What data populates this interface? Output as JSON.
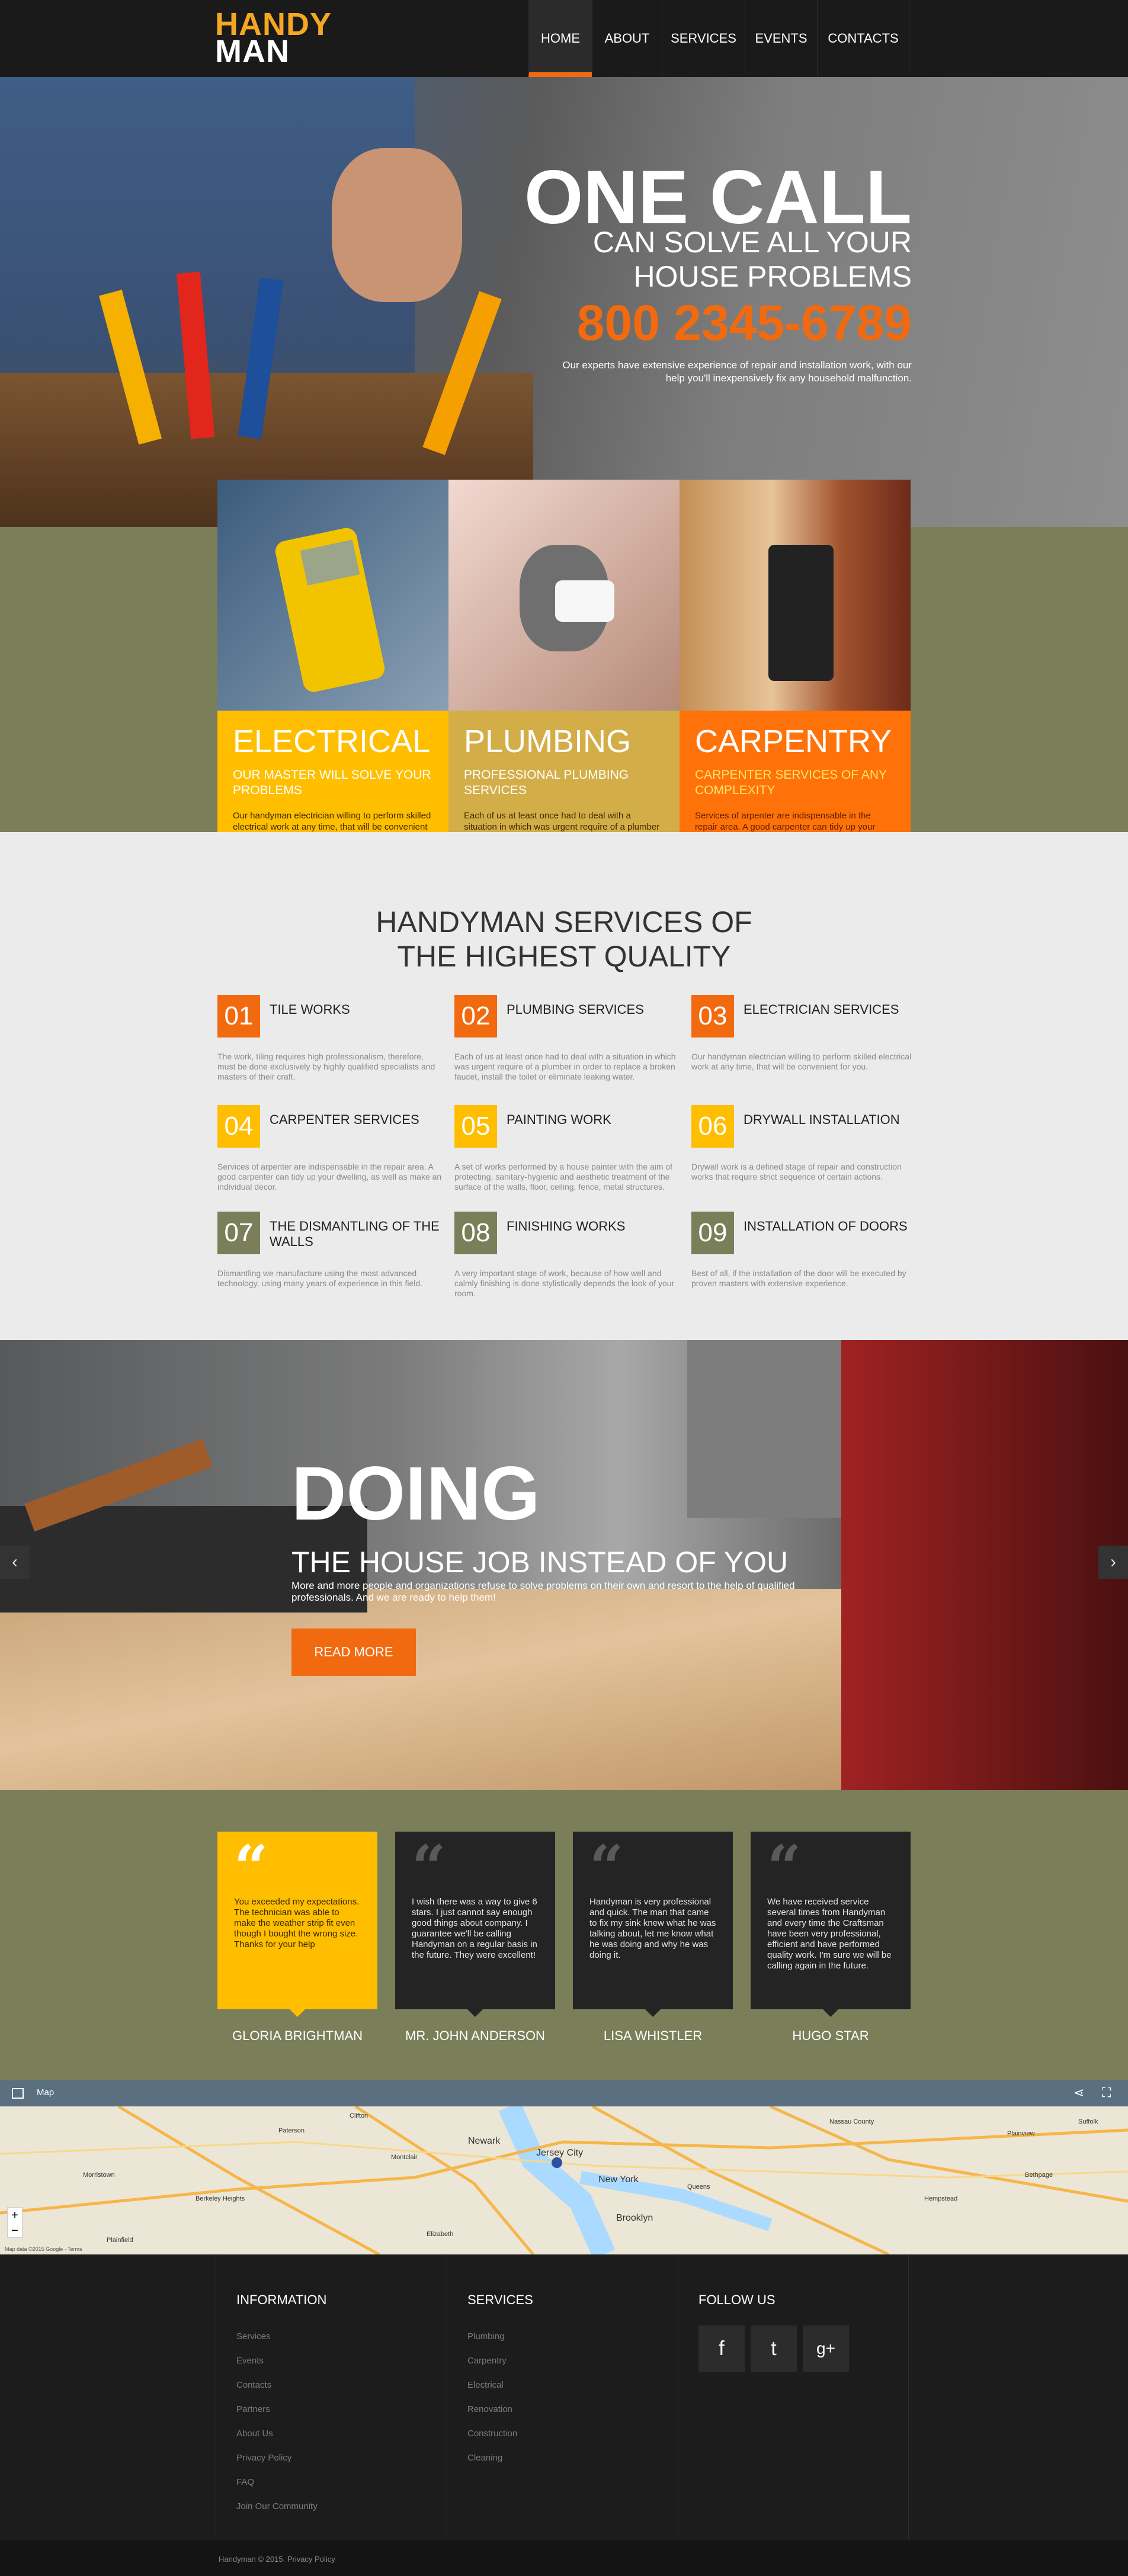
{
  "brand": {
    "line1": "HANDY",
    "line2": "MAN"
  },
  "nav": [
    {
      "label": "HOME",
      "active": true
    },
    {
      "label": "ABOUT",
      "active": false
    },
    {
      "label": "SERVICES",
      "active": false
    },
    {
      "label": "EVENTS",
      "active": false
    },
    {
      "label": "CONTACTS",
      "active": false
    }
  ],
  "hero": {
    "title": "ONE CALL",
    "subtitle": "CAN SOLVE ALL YOUR\nHOUSE PROBLEMS",
    "phone": "800 2345-6789",
    "text": "Our experts have extensive experience of repair and installation work, with our help you'll inexpensively fix any household malfunction."
  },
  "feature_cards": [
    {
      "title": "ELECTRICAL",
      "subtitle": "OUR MASTER WILL SOLVE YOUR PROBLEMS",
      "text": "Our handyman electrician willing to perform skilled electrical work at any time, that will be convenient for you. Electricity is communication, without which it would be difficult to imagine modern life.",
      "color": "#ffbe00"
    },
    {
      "title": "PLUMBING",
      "subtitle": "PROFESSIONAL PLUMBING SERVICES",
      "text": "Each of us at least once had to deal with a situation in which was urgent require of a plumber in order to replace a broken faucet, install the toilet or eliminate leaking water from the sewer pipes.",
      "color": "#d3ad47"
    },
    {
      "title": "CARPENTRY",
      "subtitle": "CARPENTER SERVICES OF ANY COMPLEXITY",
      "text": "Services of arpenter are  indispensable in the repair area. A good carpenter can tidy up your dwelling, as well as make an individual decor.",
      "color": "#ff720a"
    }
  ],
  "services_section": {
    "title": "HANDYMAN SERVICES OF\nTHE HIGHEST QUALITY",
    "items": [
      {
        "num": "01",
        "title": "TILE WORKS",
        "text": "The work, tiling requires high professionalism, therefore, must be done exclusively by highly qualified specialists and masters of their craft.",
        "color": "#f26a0f"
      },
      {
        "num": "04",
        "title": "CARPENTER SERVICES",
        "text": "Services of arpenter are  indispensable in the repair area. A good carpenter can tidy up your dwelling, as well as make an individual decor.",
        "color": "#ffbe00"
      },
      {
        "num": "07",
        "title": "THE DISMANTLING OF THE WALLS",
        "text": "Dismantling we manufacture using the most advanced technology, using many years of experience in this field.",
        "color": "#7a7f5a"
      },
      {
        "num": "02",
        "title": "PLUMBING SERVICES",
        "text": "Each of us at least once had to deal with a situation in which was urgent require of a plumber in order to replace a broken faucet, install the toilet or eliminate leaking water.",
        "color": "#f26a0f"
      },
      {
        "num": "05",
        "title": "PAINTING WORK",
        "text": "A set of works performed by a house painter with the aim of protecting, sanitary-hygienic and aesthetic treatment of the surface of the walls, floor, ceiling, fence, metal structures.",
        "color": "#ffbe00"
      },
      {
        "num": "08",
        "title": "FINISHING WORKS",
        "text": "A very important stage of work, because of how well and calmly finishing is done stylistically depends the look of your room.",
        "color": "#7a7f5a"
      },
      {
        "num": "03",
        "title": "ELECTRICIAN SERVICES",
        "text": "Our handyman electrician willing to perform skilled electrical work at any time, that will be convenient for you.",
        "color": "#f26a0f"
      },
      {
        "num": "06",
        "title": "DRYWALL INSTALLATION",
        "text": "Drywall work is a defined stage of repair and construction works that require strict sequence of certain actions.",
        "color": "#ffbe00"
      },
      {
        "num": "09",
        "title": "INSTALLATION OF DOORS",
        "text": "Best of all, if the installation of the door will be executed by proven masters with extensive experience.",
        "color": "#7a7f5a"
      }
    ]
  },
  "slider": {
    "title": "DOING",
    "subtitle": "THE HOUSE JOB INSTEAD OF YOU",
    "text": "More and more people and organizations refuse to solve problems on their own and resort to the help of qualified professionals. And we are ready to help them!",
    "button": "READ MORE",
    "prev_icon": "chevron-left-icon",
    "next_icon": "chevron-right-icon"
  },
  "testimonials": [
    {
      "quote": "You exceeded my expectations. The technician was able to make the weather strip fit even though I bought the wrong size. Thanks for your help",
      "name": "GLORIA BRIGHTMAN",
      "highlight": true
    },
    {
      "quote": "I wish there was a way to give 6 stars. I just cannot say enough good things about company. I guarantee we'll be calling Handyman on a regular basis in the future. They were excellent!",
      "name": "MR. JOHN ANDERSON",
      "highlight": false
    },
    {
      "quote": "Handyman is very professional and quick. The man that came to fix my sink knew what he was talking about, let me know what he was doing and why he was doing it.",
      "name": "LISA WHISTLER",
      "highlight": false
    },
    {
      "quote": "We have received service several times from Handyman and every time the Craftsman have been very professional, efficient and have performed quality work. I'm sure we will be calling again in the future.",
      "name": "HUGO STAR",
      "highlight": false
    }
  ],
  "map": {
    "label": "Map",
    "places": [
      "Newark",
      "Jersey City",
      "New York",
      "Brooklyn",
      "Queens",
      "Elizabeth",
      "Paterson",
      "Clifton",
      "Hempstead",
      "Bethpage",
      "Plainview",
      "Montclair",
      "Morristown",
      "Berkeley Heights",
      "Plainfield",
      "Nassau County",
      "Suffolk"
    ],
    "footer_text": "Map data ©2015 Google · Terms"
  },
  "footer": {
    "information": {
      "title": "INFORMATION",
      "links": [
        "Services",
        "Events",
        "Contacts",
        "Partners",
        "About Us",
        "Privacy Policy",
        "FAQ",
        "Join Our Community"
      ]
    },
    "services": {
      "title": "SERVICES",
      "links": [
        "Plumbing",
        "Carpentry",
        "Electrical",
        "Renovation",
        "Construction",
        "Cleaning"
      ]
    },
    "follow": {
      "title": "FOLLOW US",
      "icons": [
        "facebook-icon",
        "twitter-icon",
        "google-plus-icon"
      ]
    },
    "copyright": "Handyman © 2015. Privacy Policy"
  },
  "colors": {
    "orange": "#f26a0f",
    "yellow": "#ffbe00",
    "olive": "#7a7f5a",
    "dark": "#1a1a1a"
  }
}
